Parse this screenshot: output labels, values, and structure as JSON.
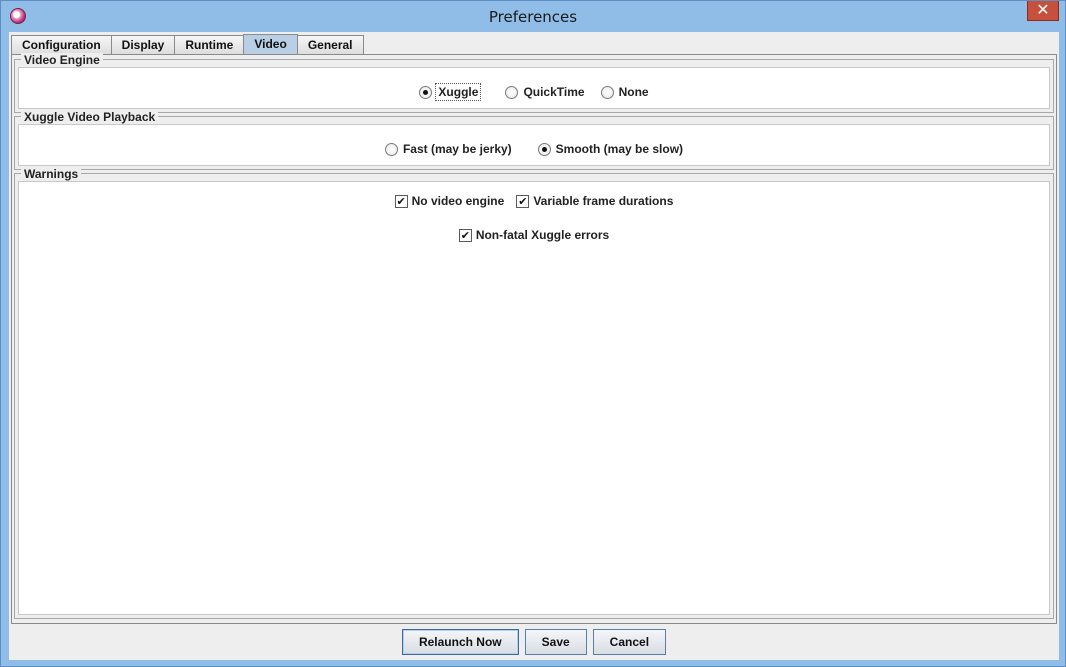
{
  "window": {
    "title": "Preferences",
    "close_label": "✕"
  },
  "tabs": [
    {
      "label": "Configuration",
      "active": false
    },
    {
      "label": "Display",
      "active": false
    },
    {
      "label": "Runtime",
      "active": false
    },
    {
      "label": "Video",
      "active": true
    },
    {
      "label": "General",
      "active": false
    }
  ],
  "video_engine": {
    "legend": "Video Engine",
    "options": [
      {
        "label": "Xuggle",
        "selected": true
      },
      {
        "label": "QuickTime",
        "selected": false
      },
      {
        "label": "None",
        "selected": false
      }
    ]
  },
  "playback": {
    "legend": "Xuggle Video Playback",
    "options": [
      {
        "label": "Fast (may be jerky)",
        "selected": false
      },
      {
        "label": "Smooth (may be slow)",
        "selected": true
      }
    ]
  },
  "warnings": {
    "legend": "Warnings",
    "items": [
      {
        "label": "No video engine",
        "checked": true
      },
      {
        "label": "Variable frame durations",
        "checked": true
      },
      {
        "label": "Non-fatal Xuggle errors",
        "checked": true
      }
    ]
  },
  "buttons": {
    "relaunch": "Relaunch Now",
    "save": "Save",
    "cancel": "Cancel"
  },
  "icons": {
    "check_glyph": "✔"
  }
}
